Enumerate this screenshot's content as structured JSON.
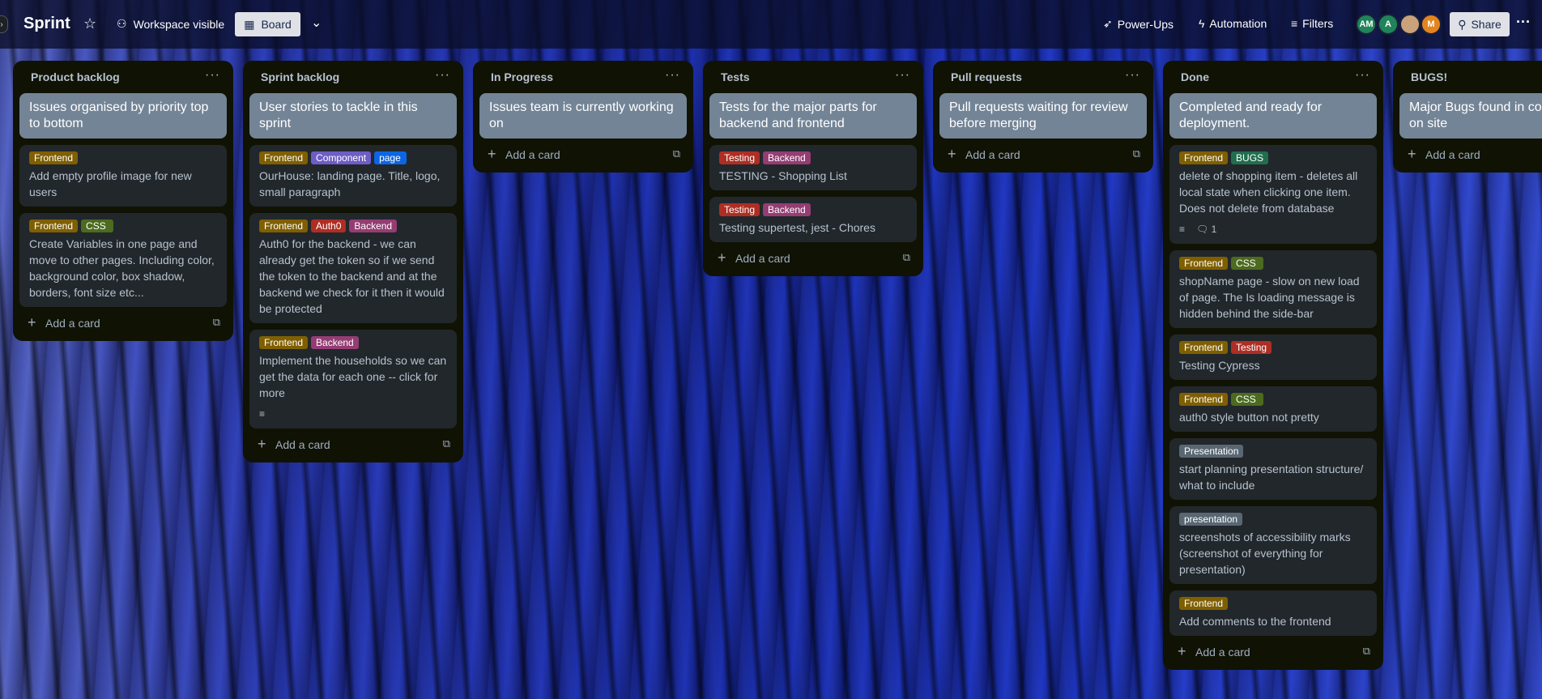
{
  "header": {
    "title": "Sprint",
    "visibility": "Workspace visible",
    "view": "Board",
    "power_ups": "Power-Ups",
    "automation": "Automation",
    "filters": "Filters",
    "share": "Share",
    "avatars": [
      {
        "initials": "AM",
        "color": "#1f845a"
      },
      {
        "initials": "A",
        "color": "#1f845a"
      },
      {
        "initials": "",
        "color": "#c9a27a"
      },
      {
        "initials": "M",
        "color": "#e2851e"
      }
    ]
  },
  "colors": {
    "Frontend": "#7f5f01",
    "CSS": "#4c6b1f",
    "Component": "#6e5dc6",
    "page": "#0c66e4",
    "Auth0": "#ae2e24",
    "Backend": "#943d73",
    "Testing": "#ae2e24",
    "BUGS": "#216e4e",
    "Presentation": "#596773",
    "presentation": "#596773"
  },
  "add_card_label": "Add a card",
  "lists": [
    {
      "title": "Product backlog",
      "cards": [
        {
          "desc": true,
          "text": "Issues organised by priority top to bottom",
          "labels": []
        },
        {
          "text": "Add empty profile image for new users",
          "labels": [
            "Frontend"
          ]
        },
        {
          "text": "Create Variables in one page and move to other pages. Including color, background color, box shadow, borders, font size etc...",
          "labels": [
            "Frontend",
            "CSS"
          ]
        }
      ]
    },
    {
      "title": "Sprint backlog",
      "cards": [
        {
          "desc": true,
          "text": "User stories to tackle in this sprint",
          "labels": []
        },
        {
          "text": "OurHouse: landing page. Title, logo, small paragraph",
          "labels": [
            "Frontend",
            "Component",
            "page"
          ]
        },
        {
          "text": "Auth0 for the backend - we can already get the token so if we send the token to the backend and at the backend we check for it then it would be protected",
          "labels": [
            "Frontend",
            "Auth0",
            "Backend"
          ]
        },
        {
          "text": "Implement the households so we can get the data for each one -- click for more",
          "labels": [
            "Frontend",
            "Backend"
          ],
          "description_icon": true
        }
      ]
    },
    {
      "title": "In Progress",
      "cards": [
        {
          "desc": true,
          "text": "Issues team is currently working on",
          "labels": []
        }
      ]
    },
    {
      "title": "Tests",
      "cards": [
        {
          "desc": true,
          "text": "Tests for the major parts for backend and frontend",
          "labels": []
        },
        {
          "text": "TESTING - Shopping List",
          "labels": [
            "Testing",
            "Backend"
          ]
        },
        {
          "text": "Testing supertest, jest - Chores",
          "labels": [
            "Testing",
            "Backend"
          ]
        }
      ]
    },
    {
      "title": "Pull requests",
      "cards": [
        {
          "desc": true,
          "text": "Pull requests waiting for review before merging",
          "labels": []
        }
      ]
    },
    {
      "title": "Done",
      "cards": [
        {
          "desc": true,
          "text": "Completed and ready for deployment.",
          "labels": []
        },
        {
          "text": "delete of shopping item - deletes all local state when clicking one item. Does not delete from database",
          "labels": [
            "Frontend",
            "BUGS"
          ],
          "description_icon": true,
          "comments": "1"
        },
        {
          "text": "shopName page - slow on new load of page. The Is loading message is hidden behind the side-bar",
          "labels": [
            "Frontend",
            "CSS"
          ]
        },
        {
          "text": "Testing Cypress",
          "labels": [
            "Frontend",
            "Testing"
          ]
        },
        {
          "text": "auth0 style button not pretty",
          "labels": [
            "Frontend",
            "CSS"
          ]
        },
        {
          "text": "start planning presentation structure/ what to include",
          "labels": [
            "Presentation"
          ]
        },
        {
          "text": "screenshots of accessibility marks (screenshot of everything for presentation)",
          "labels": [
            "presentation"
          ]
        },
        {
          "text": "Add comments to the frontend",
          "labels": [
            "Frontend"
          ]
        }
      ]
    },
    {
      "title": "BUGS!",
      "cards": [
        {
          "desc": true,
          "text": "Major Bugs found in code and on site",
          "labels": []
        }
      ]
    }
  ]
}
